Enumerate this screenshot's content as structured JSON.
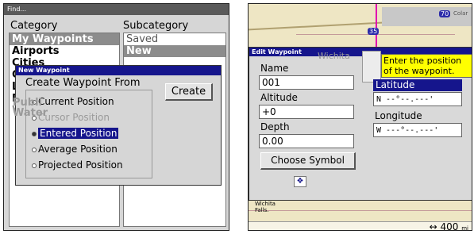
{
  "left": {
    "title": "Find...",
    "category_label": "Category",
    "subcategory_label": "Subcategory",
    "categories": [
      "My Waypoints",
      "Airports",
      "Cities",
      "C",
      "L",
      "P",
      "W"
    ],
    "partial_labels": [
      "Publi",
      "Water"
    ],
    "subcategories": [
      "Saved",
      "New"
    ],
    "dialog": {
      "title": "New Waypoint",
      "group_label": "Create Waypoint From",
      "create_button": "Create",
      "options": [
        {
          "label": "Current Position",
          "enabled": true,
          "selected": false
        },
        {
          "label": "Cursor Position",
          "enabled": false,
          "selected": false
        },
        {
          "label": "Entered Position",
          "enabled": true,
          "selected": true
        },
        {
          "label": "Average Position",
          "enabled": true,
          "selected": false
        },
        {
          "label": "Projected Position",
          "enabled": true,
          "selected": false
        }
      ]
    }
  },
  "right": {
    "map_labels": {
      "highway_35": "35",
      "highway_70": "70",
      "city_top": "Wichita",
      "city_bottom": "Wichita Falls.",
      "colar": "Colar"
    },
    "dialog": {
      "title": "Edit Waypoint",
      "name_label": "Name",
      "name_value": "001",
      "altitude_label": "Altitude",
      "altitude_value": "+0",
      "depth_label": "Depth",
      "depth_value": "0.00",
      "choose_symbol_button": "Choose Symbol",
      "latitude_label": "Latitude",
      "latitude_value": "N   --°--.---'",
      "longitude_label": "Longitude",
      "longitude_value": "W   ---°--.---'",
      "tooltip": "Enter the position of the waypoint."
    },
    "scale": {
      "icon": "↔",
      "value": "400",
      "unit": "mi"
    }
  },
  "colors": {
    "dialog_title": "#15158c",
    "tooltip": "#ffff00",
    "selected_gray": "#8c8c8c"
  }
}
